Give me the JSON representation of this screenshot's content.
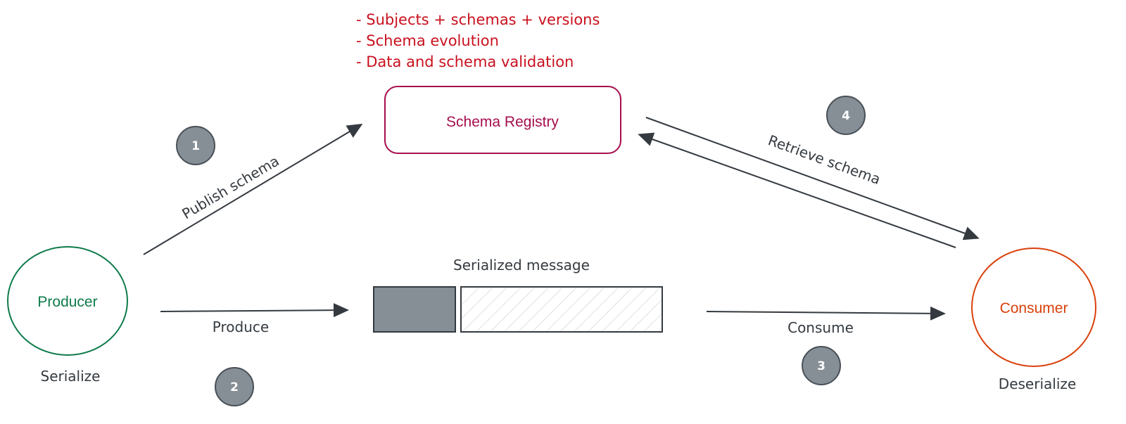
{
  "notes": {
    "items": [
      "- Subjects + schemas + versions",
      "- Schema evolution",
      "- Data and schema validation"
    ],
    "color": "#c9111e"
  },
  "nodes": {
    "schema_registry": {
      "label": "Schema Registry",
      "color": "#a50e4d"
    },
    "producer": {
      "label": "Producer",
      "sublabel": "Serialize",
      "color": "#0f7b4a"
    },
    "consumer": {
      "label": "Consumer",
      "sublabel": "Deserialize",
      "color": "#d9400b"
    },
    "message": {
      "label": "Serialized message",
      "schema_block_color": "#868e96"
    }
  },
  "edges": {
    "publish": {
      "label": "Publish schema",
      "step": "1"
    },
    "produce": {
      "label": "Produce",
      "step": "2"
    },
    "consume": {
      "label": "Consume",
      "step": "3"
    },
    "retrieve": {
      "label": "Retrieve schema",
      "step": "4"
    }
  },
  "colors": {
    "arrow": "#343a40",
    "badge_fill": "#868e96",
    "badge_stroke": "#495057",
    "hatch": "#ced4da"
  }
}
